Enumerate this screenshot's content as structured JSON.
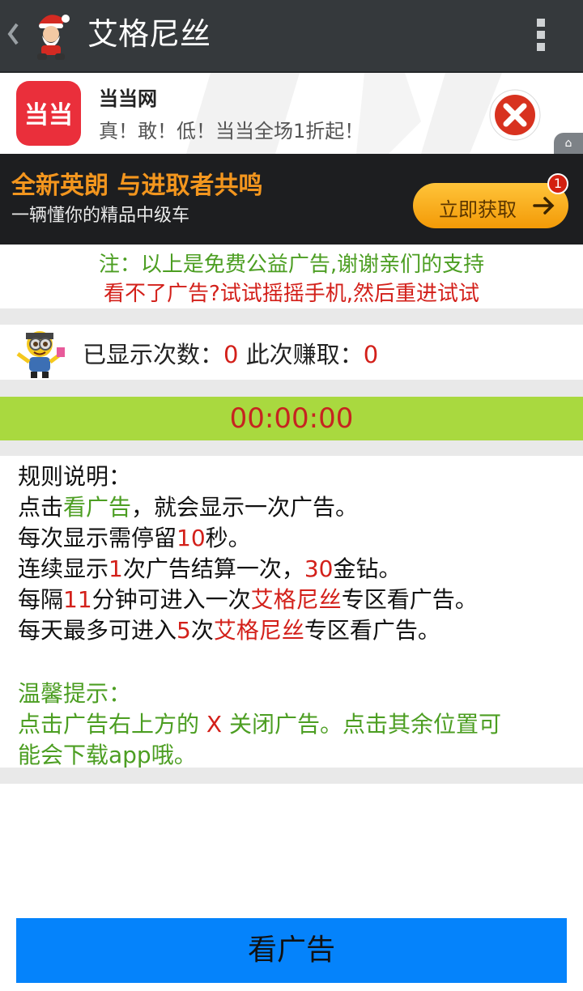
{
  "app_bar": {
    "title": "艾格尼丝",
    "back_icon": "chevron-left-icon",
    "avatar_icon": "santa-avatar-icon",
    "overflow_icon": "overflow-menu-icon"
  },
  "ad_banner_1": {
    "brand": "当当网",
    "logo_text": "当当",
    "description": "真！敢！低！当当全场1折起！",
    "close_icon": "close-icon",
    "ad_tag_icon": "ad-tag-icon"
  },
  "ad_banner_2": {
    "title": "全新英朗 与进取者共鸣",
    "subtitle": "一辆懂你的精品中级车",
    "button_label": "立即获取",
    "badge": "1",
    "arrow_icon": "arrow-right-icon"
  },
  "notice": {
    "line1": "注：以上是免费公益广告,谢谢亲们的支持",
    "line2": "看不了广告?试试摇摇手机,然后重进试试"
  },
  "counter": {
    "shown_label": "已显示次数：",
    "shown_value": "0",
    "earned_label": " 此次赚取：",
    "earned_value": "0",
    "mascot_icon": "minion-mascot-icon"
  },
  "timer": "00:00:00",
  "rules": {
    "heading": "规则说明：",
    "l1_a": "点击",
    "l1_b": "看广告",
    "l1_c": "，就会显示一次广告。",
    "l2_a": "每次显示需停留",
    "l2_b": "10",
    "l2_c": "秒。",
    "l3_a": "连续显示",
    "l3_b": "1",
    "l3_c": "次广告结算一次，",
    "l3_d": "30",
    "l3_e": "金钻。",
    "l4_a": "每隔",
    "l4_b": "11",
    "l4_c": "分钟可进入一次",
    "l4_d": "艾格尼丝",
    "l4_e": "专区看广告。",
    "l5_a": "每天最多可进入",
    "l5_b": "5",
    "l5_c": "次",
    "l5_d": "艾格尼丝",
    "l5_e": "专区看广告。"
  },
  "tips": {
    "heading": "温馨提示：",
    "l1_a": "点击广告右上方的 ",
    "l1_b": "X",
    "l1_c": " 关闭广告。点击其余位置可",
    "l2": "能会下载app哦。"
  },
  "watch_button": "看广告",
  "colors": {
    "app_bar": "#35393c",
    "timer_bg": "#a9d93f",
    "accent_red": "#d3201a",
    "accent_green": "#4c9e22",
    "button_blue": "#0583fb"
  }
}
